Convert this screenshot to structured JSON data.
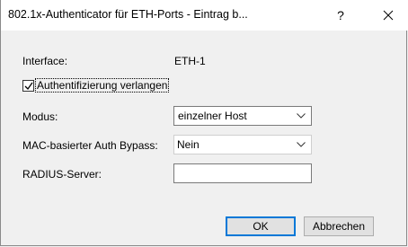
{
  "window": {
    "title": "802.1x-Authenticator für ETH-Ports - Eintrag b...",
    "help_glyph": "?",
    "close_icon": "close-icon"
  },
  "form": {
    "interface_label": "Interface:",
    "interface_value": "ETH-1",
    "auth_required_label": "Authentifizierung verlangen",
    "auth_required_checked": true,
    "mode_label": "Modus:",
    "mode_value": "einzelner Host",
    "mac_bypass_label": "MAC-basierter Auth Bypass:",
    "mac_bypass_value": "Nein",
    "radius_label": "RADIUS-Server:",
    "radius_value": ""
  },
  "buttons": {
    "ok": "OK",
    "cancel": "Abbrechen"
  }
}
